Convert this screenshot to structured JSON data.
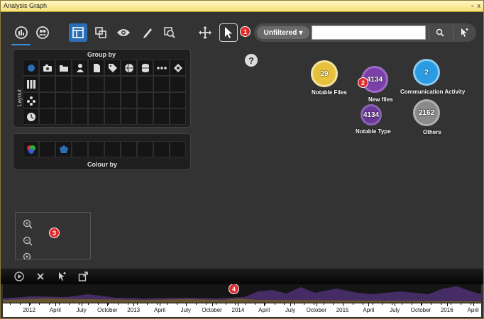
{
  "window": {
    "title": "Analysis Graph",
    "controls": [
      "▫",
      "x"
    ]
  },
  "toolbar": {
    "filter_label": "Unfiltered",
    "search_value": "",
    "search_placeholder": ""
  },
  "markers": [
    "1",
    "2",
    "3",
    "4"
  ],
  "group_by": {
    "title": "Group by",
    "layout_label": "Layout",
    "icons": [
      "circle-icon",
      "camera-icon",
      "folder-icon",
      "person-icon",
      "document-icon",
      "tags-icon",
      "globe-icon",
      "database-icon",
      "more-icon",
      "diamond-icon"
    ],
    "layout_icons": [
      "columns-icon",
      "cluster-icon",
      "clock-icon"
    ]
  },
  "colour_by": {
    "title": "Colour by"
  },
  "help": "?",
  "nodes": [
    {
      "count": "29",
      "label": "Notable Files",
      "color": "#e6c23c"
    },
    {
      "count": "4134",
      "label": "New files",
      "color": "#7b3fa8"
    },
    {
      "count": "2",
      "label": "Communication Activity",
      "color": "#2b9be3"
    },
    {
      "count": "4134",
      "label": "Notable Type",
      "color": "#6a3a98"
    },
    {
      "count": "2162",
      "label": "Others",
      "color": "#8a8a8a"
    }
  ],
  "timeline": {
    "ticks": [
      "2012",
      "April",
      "July",
      "October",
      "2013",
      "April",
      "July",
      "October",
      "2014",
      "April",
      "July",
      "October",
      "2015",
      "April",
      "July",
      "October",
      "2016",
      "April"
    ]
  },
  "colors": {
    "accent": "#2a6fb5",
    "marker": "#e02a2a"
  }
}
